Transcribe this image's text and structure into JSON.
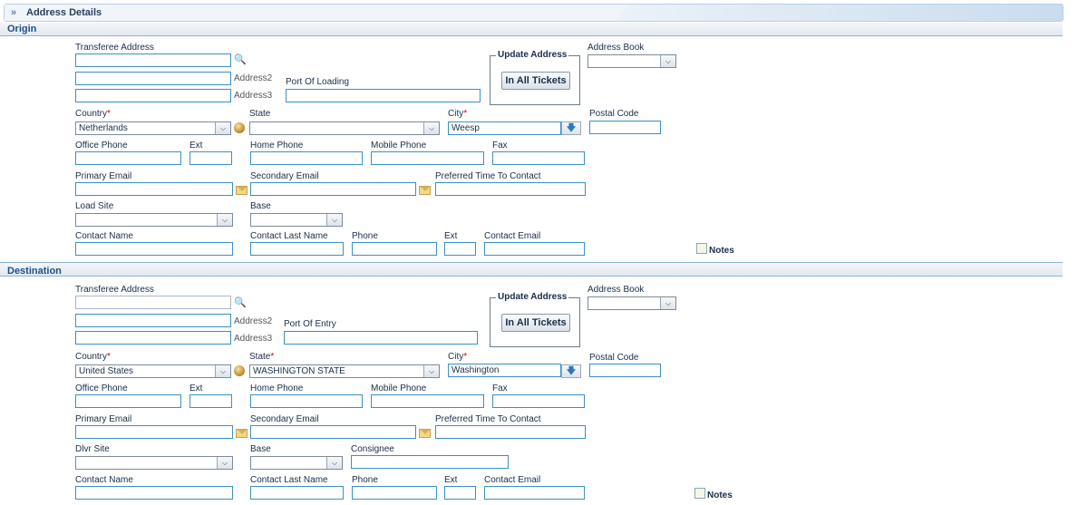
{
  "panel": {
    "title": "Address Details"
  },
  "origin": {
    "section_title": "Origin",
    "transferee_address_label": "Transferee Address",
    "address2_label": "Address2",
    "address3_label": "Address3",
    "port_label": "Port Of Loading",
    "update_address_legend": "Update Address",
    "in_all_tickets_label": "In All Tickets",
    "address_book_label": "Address Book",
    "country_label": "Country",
    "country_value": "Netherlands",
    "state_label": "State",
    "state_value": "",
    "city_label": "City",
    "city_value": "Weesp",
    "postal_code_label": "Postal Code",
    "office_phone_label": "Office Phone",
    "ext_label": "Ext",
    "home_phone_label": "Home Phone",
    "mobile_phone_label": "Mobile Phone",
    "fax_label": "Fax",
    "primary_email_label": "Primary Email",
    "secondary_email_label": "Secondary Email",
    "preferred_time_label": "Preferred Time To Contact",
    "site_label": "Load Site",
    "base_label": "Base",
    "contact_name_label": "Contact Name",
    "contact_last_name_label": "Contact Last Name",
    "phone_label": "Phone",
    "ext2_label": "Ext",
    "contact_email_label": "Contact Email",
    "notes_label": "Notes"
  },
  "destination": {
    "section_title": "Destination",
    "transferee_address_label": "Transferee Address",
    "address2_label": "Address2",
    "address3_label": "Address3",
    "port_label": "Port Of Entry",
    "update_address_legend": "Update Address",
    "in_all_tickets_label": "In All Tickets",
    "address_book_label": "Address Book",
    "country_label": "Country",
    "country_value": "United States",
    "state_label": "State",
    "state_value": "WASHINGTON STATE",
    "city_label": "City",
    "city_value": "Washington",
    "postal_code_label": "Postal Code",
    "office_phone_label": "Office Phone",
    "ext_label": "Ext",
    "home_phone_label": "Home Phone",
    "mobile_phone_label": "Mobile Phone",
    "fax_label": "Fax",
    "primary_email_label": "Primary Email",
    "secondary_email_label": "Secondary Email",
    "preferred_time_label": "Preferred Time To Contact",
    "site_label": "Dlvr Site",
    "base_label": "Base",
    "consignee_label": "Consignee",
    "contact_name_label": "Contact Name",
    "contact_last_name_label": "Contact Last Name",
    "phone_label": "Phone",
    "ext2_label": "Ext",
    "contact_email_label": "Contact Email",
    "notes_label": "Notes"
  },
  "required_marker": "*",
  "icons": {
    "panel": "double-chevron-icon",
    "lookup": "magnifier-icon",
    "country_lookup": "globe-icon",
    "city_lookup": "download-arrow-icon",
    "email": "envelope-icon",
    "notes": "notes-icon"
  }
}
